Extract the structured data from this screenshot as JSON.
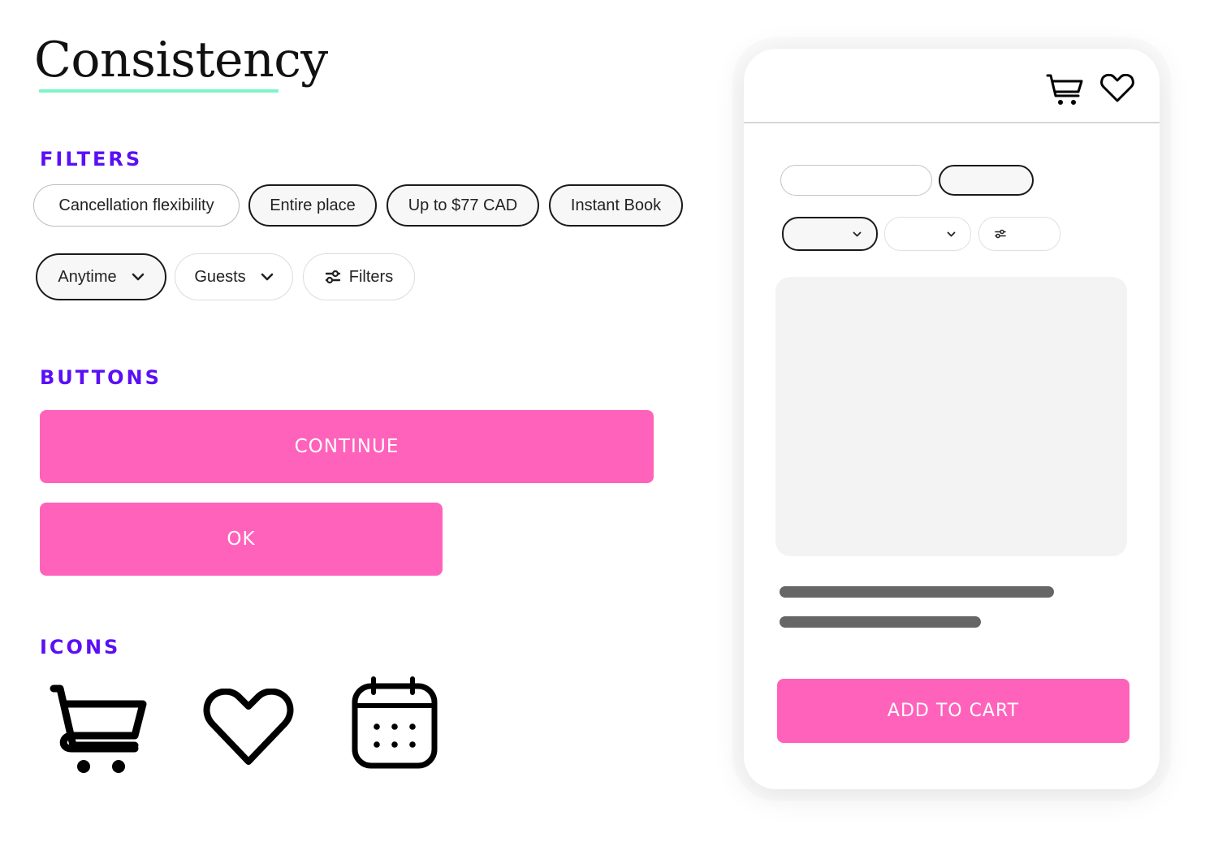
{
  "title": "Consistency",
  "colors": {
    "accent_purple": "#5b0ff5",
    "pink": "#ff62bb",
    "underline_mint": "#7ef5c6",
    "placeholder_gray": "#f3f3f3",
    "text_line_gray": "#666666"
  },
  "filters": {
    "heading": "FILTERS",
    "row1": [
      {
        "label": "Cancellation flexibility",
        "selected": false
      },
      {
        "label": "Entire place",
        "selected": true
      },
      {
        "label": "Up to $77 CAD",
        "selected": true
      },
      {
        "label": "Instant Book",
        "selected": true
      }
    ],
    "row2": [
      {
        "label": "Anytime",
        "icon": "chevron-down-icon",
        "selected": true
      },
      {
        "label": "Guests",
        "icon": "chevron-down-icon",
        "selected": false
      },
      {
        "label": "Filters",
        "icon": "sliders-icon",
        "selected": false
      }
    ]
  },
  "buttons": {
    "heading": "BUTTONS",
    "continue_label": "CONTINUE",
    "ok_label": "OK"
  },
  "icons": {
    "heading": "ICONS",
    "items": [
      "cart-icon",
      "heart-icon",
      "calendar-icon"
    ]
  },
  "phone_mockup": {
    "header_icons": [
      "cart-icon",
      "heart-icon"
    ],
    "add_to_cart_label": "ADD TO CART"
  }
}
